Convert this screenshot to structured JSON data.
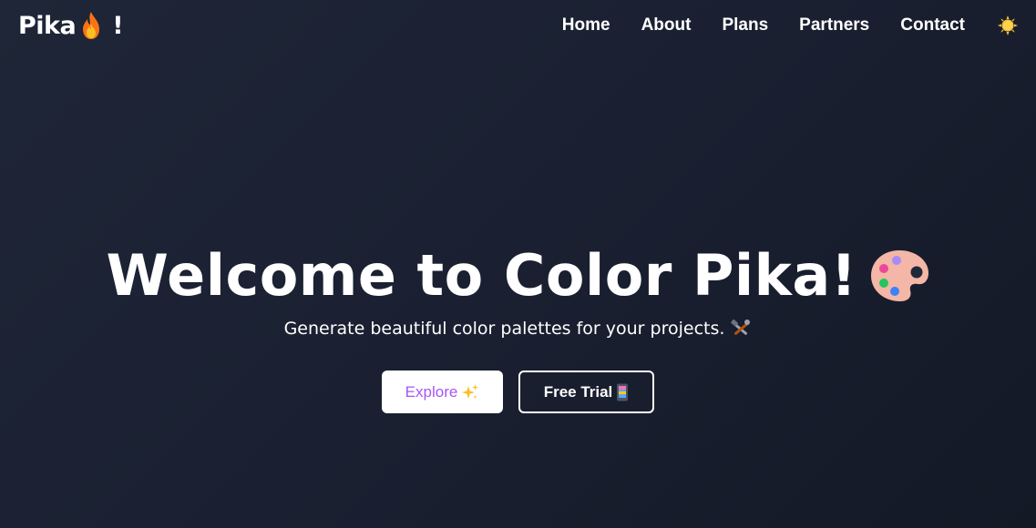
{
  "nav": {
    "brand_text": "Pika",
    "brand_suffix": "!",
    "brand_icon": "fire-icon",
    "links": [
      {
        "label": "Home"
      },
      {
        "label": "About"
      },
      {
        "label": "Plans"
      },
      {
        "label": "Partners"
      },
      {
        "label": "Contact"
      }
    ],
    "theme_toggle_icon": "sun-icon"
  },
  "hero": {
    "title": "Welcome to Color Pika!",
    "title_icon": "palette-icon",
    "subtitle": "Generate beautiful color palettes for your projects.",
    "subtitle_icon": "tools-icon",
    "buttons": {
      "explore_label": "Explore",
      "explore_icon": "sparkles-icon",
      "trial_label": "Free Trial",
      "trial_icon": "phone-icon"
    }
  },
  "colors": {
    "background": "#1c2233",
    "explore_text": "#a855f7",
    "accent_orange": "#f97316",
    "sun": "#f8c23c"
  }
}
